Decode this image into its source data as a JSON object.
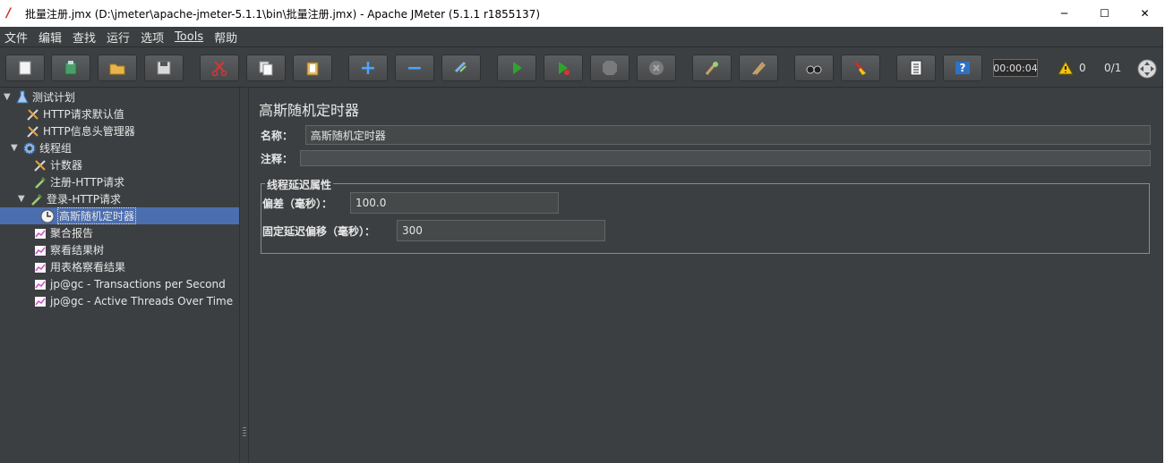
{
  "window": {
    "title": "批量注册.jmx (D:\\jmeter\\apache-jmeter-5.1.1\\bin\\批量注册.jmx) - Apache JMeter (5.1.1 r1855137)",
    "app_icon_glyph": "/",
    "controls": {
      "minimize": "─",
      "maximize": "☐",
      "close": "✕"
    }
  },
  "menu": [
    "文件",
    "编辑",
    "查找",
    "运行",
    "选项",
    "Tools",
    "帮助"
  ],
  "toolbar": {
    "buttons": [
      {
        "name": "new-icon"
      },
      {
        "name": "templates-icon"
      },
      {
        "name": "open-icon"
      },
      {
        "name": "save-icon"
      },
      {
        "name": "cut-icon"
      },
      {
        "name": "copy-icon"
      },
      {
        "name": "paste-icon"
      },
      {
        "name": "expand-icon",
        "glyph": "+"
      },
      {
        "name": "collapse-icon",
        "glyph": "−"
      },
      {
        "name": "toggle-icon"
      },
      {
        "name": "start-icon"
      },
      {
        "name": "start-no-pause-icon"
      },
      {
        "name": "stop-icon",
        "glyph": "STOP"
      },
      {
        "name": "shutdown-icon"
      },
      {
        "name": "remote-start-icon"
      },
      {
        "name": "remote-stop-icon"
      },
      {
        "name": "search-icon"
      },
      {
        "name": "clear-all-icon"
      },
      {
        "name": "function-helper-icon"
      },
      {
        "name": "help-icon",
        "glyph": "?"
      }
    ],
    "timer": "00:00:04",
    "warning_count": "0",
    "threads": "0/1"
  },
  "tree": [
    {
      "label": "测试计划",
      "level": 0,
      "toggle": "▼",
      "icon": "flask-icon"
    },
    {
      "label": "HTTP请求默认值",
      "level": 1,
      "toggle": "",
      "icon": "wrench-icon"
    },
    {
      "label": "HTTP信息头管理器",
      "level": 1,
      "toggle": "",
      "icon": "wrench-icon"
    },
    {
      "label": "线程组",
      "level": 1,
      "toggle": "▼",
      "icon": "gear-icon"
    },
    {
      "label": "计数器",
      "level": 2,
      "toggle": "",
      "icon": "wrench-icon"
    },
    {
      "label": "注册-HTTP请求",
      "level": 2,
      "toggle": "",
      "icon": "pipette-icon"
    },
    {
      "label": "登录-HTTP请求",
      "level": 2,
      "toggle": "▼",
      "icon": "pipette-icon"
    },
    {
      "label": "高斯随机定时器",
      "level": 3,
      "toggle": "",
      "icon": "clock-icon",
      "selected": true
    },
    {
      "label": "聚合报告",
      "level": 2,
      "toggle": "",
      "icon": "graph-icon"
    },
    {
      "label": "察看结果树",
      "level": 2,
      "toggle": "",
      "icon": "graph-icon"
    },
    {
      "label": "用表格察看结果",
      "level": 2,
      "toggle": "",
      "icon": "graph-icon"
    },
    {
      "label": "jp@gc - Transactions per Second",
      "level": 2,
      "toggle": "",
      "icon": "graph-icon"
    },
    {
      "label": "jp@gc - Active Threads Over Time",
      "level": 2,
      "toggle": "",
      "icon": "graph-icon"
    }
  ],
  "panel": {
    "title": "高斯随机定时器",
    "name_label": "名称：",
    "name_value": "高斯随机定时器",
    "comment_label": "注释：",
    "comment_value": "",
    "group_title": "线程延迟属性",
    "deviation_label": "偏差（毫秒）：",
    "deviation_value": "100.0",
    "offset_label": "固定延迟偏移（毫秒）：",
    "offset_value": "300"
  },
  "colors": {
    "background": "#3c3f41",
    "selection": "#4b6eaf",
    "run_green": "#2fa32f",
    "warning_yellow": "#f2c40f"
  }
}
